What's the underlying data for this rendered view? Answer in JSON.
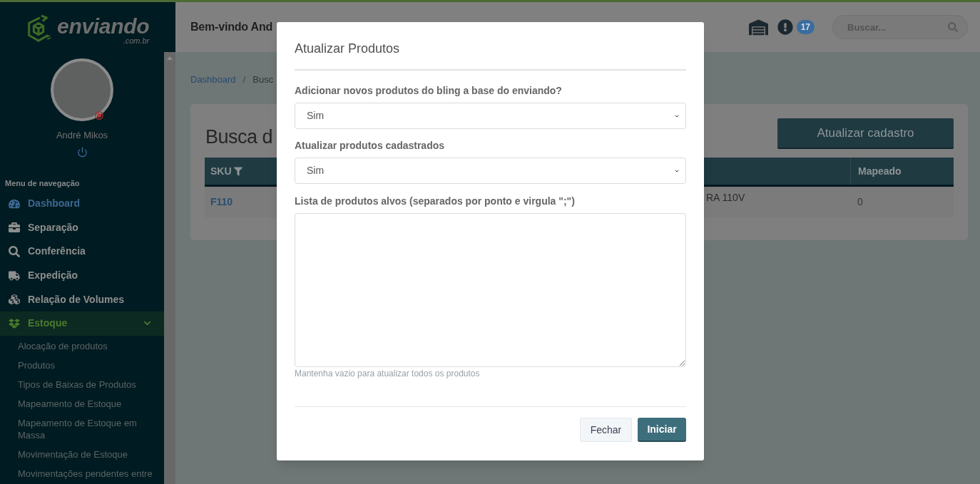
{
  "sidebar": {
    "logo": {
      "name": "enviando",
      "domain": ".com.br"
    },
    "user": {
      "name": "André Mikos"
    },
    "menu_title": "Menu de navegação",
    "items": [
      {
        "label": "Dashboard",
        "selected": true,
        "expanded": false
      },
      {
        "label": "Separação",
        "selected": false,
        "expanded": false
      },
      {
        "label": "Conferência",
        "selected": false,
        "expanded": false
      },
      {
        "label": "Expedição",
        "selected": false,
        "expanded": false
      },
      {
        "label": "Relação de Volumes",
        "selected": false,
        "expanded": false
      },
      {
        "label": "Estoque",
        "selected": false,
        "expanded": true,
        "children": [
          {
            "label": "Alocação de produtos"
          },
          {
            "label": "Produtos"
          },
          {
            "label": "Tipos de Baixas de Produtos"
          },
          {
            "label": "Mapeamento de Estoque"
          },
          {
            "label": "Mapeamento de Estoque em Massa"
          },
          {
            "label": "Movimentação de Estoque"
          },
          {
            "label": "Movimentações pendentes entre"
          }
        ]
      }
    ]
  },
  "header": {
    "title": "Bem-vindo And",
    "notification_count": "17",
    "search": {
      "placeholder": "Buscar..."
    }
  },
  "breadcrumb": {
    "items": [
      "Dashboard",
      "Busc"
    ],
    "separator": "/"
  },
  "card": {
    "title": "Busca d",
    "button": "Atualizar cadastro",
    "table": {
      "columns": [
        "SKU",
        "",
        "Mapeado"
      ],
      "rows": [
        {
          "cells": [
            "F110",
            "RA 110V",
            "0"
          ]
        }
      ]
    }
  },
  "modal": {
    "title": "Atualizar Produtos",
    "fields": [
      {
        "kind": "select",
        "label": "Adicionar novos produtos do bling a base do enviando?",
        "value": "Sim"
      },
      {
        "kind": "select",
        "label": "Atualizar produtos cadastrados",
        "value": "Sim"
      },
      {
        "kind": "textarea",
        "label": "Lista de produtos alvos (separados por ponto e virgula \";\")",
        "help": "Mantenha vazio para atualizar todos os produtos"
      }
    ],
    "buttons": [
      {
        "label": "Fechar",
        "kind": "secondary"
      },
      {
        "label": "Iniciar",
        "kind": "primary"
      }
    ]
  }
}
